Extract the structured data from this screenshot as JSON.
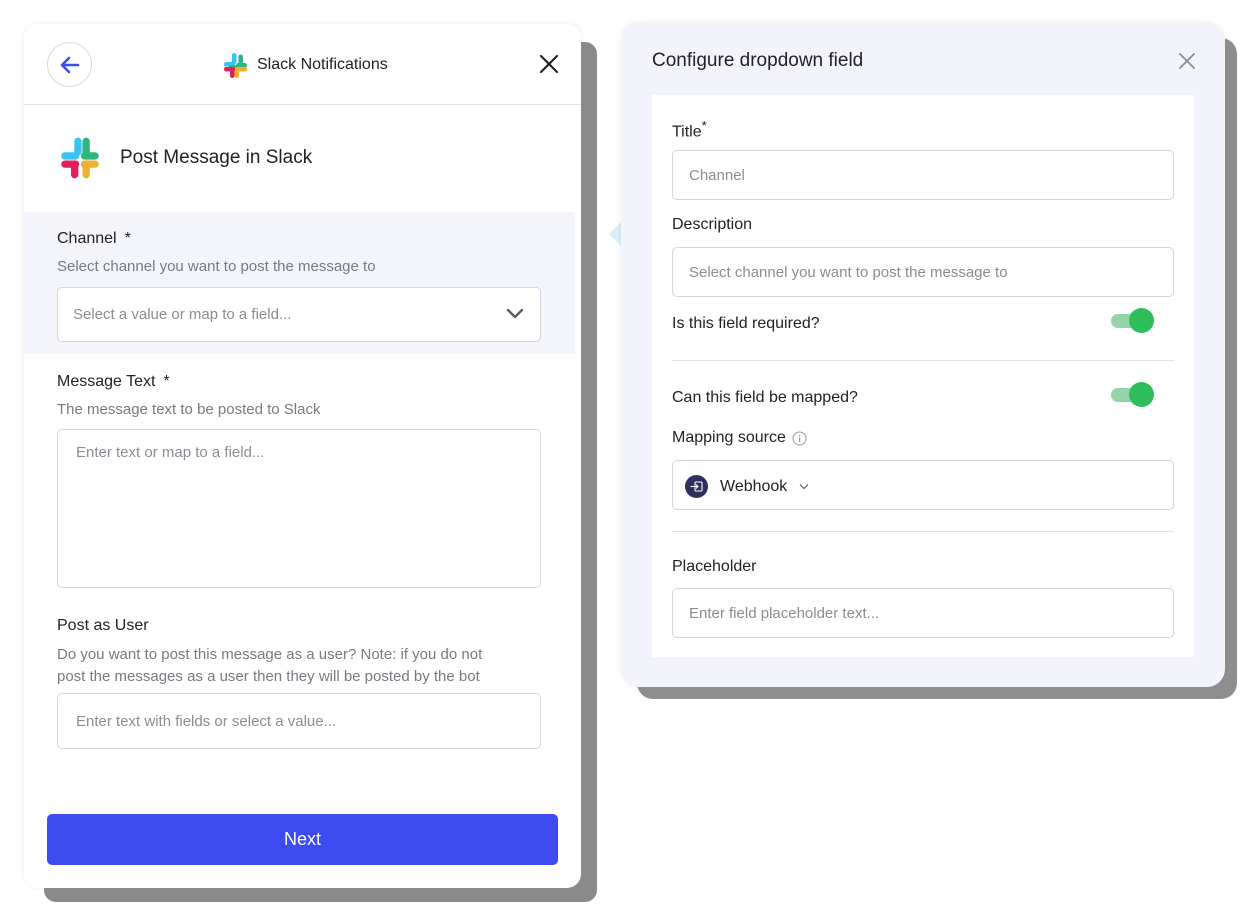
{
  "left_panel": {
    "header_title": "Slack Notifications",
    "post_title": "Post Message in Slack",
    "fields": {
      "channel": {
        "label": "Channel",
        "required_mark": "*",
        "help": "Select channel you want to post the message to",
        "placeholder": "Select a value or map to a field..."
      },
      "message_text": {
        "label": "Message Text",
        "required_mark": "*",
        "help": "The message text to be posted to Slack",
        "placeholder": "Enter text or map to a field..."
      },
      "post_as_user": {
        "label": "Post as User",
        "help_line1": "Do you want to post this message as a user? Note: if you do not",
        "help_line2": "post the messages as a user then they will be posted by the bot",
        "placeholder": "Enter text with fields or select a value..."
      }
    },
    "next_label": "Next"
  },
  "right_panel": {
    "title": "Configure dropdown field",
    "title_label": "Title",
    "title_required": "*",
    "title_value": "Channel",
    "description_label": "Description",
    "description_value": "Select channel you want to post the message to",
    "required_question": "Is this field required?",
    "required_on": true,
    "mapped_question": "Can this field be mapped?",
    "mapped_on": true,
    "mapping_source_label": "Mapping source",
    "mapping_source_value": "Webhook",
    "placeholder_label": "Placeholder",
    "placeholder_value": "Enter field placeholder text..."
  },
  "colors": {
    "primary": "#3e4bf0",
    "toggle_on": "#2dbd5b",
    "toggle_track": "#94d4a7",
    "panel_bg": "#f3f4fb"
  }
}
